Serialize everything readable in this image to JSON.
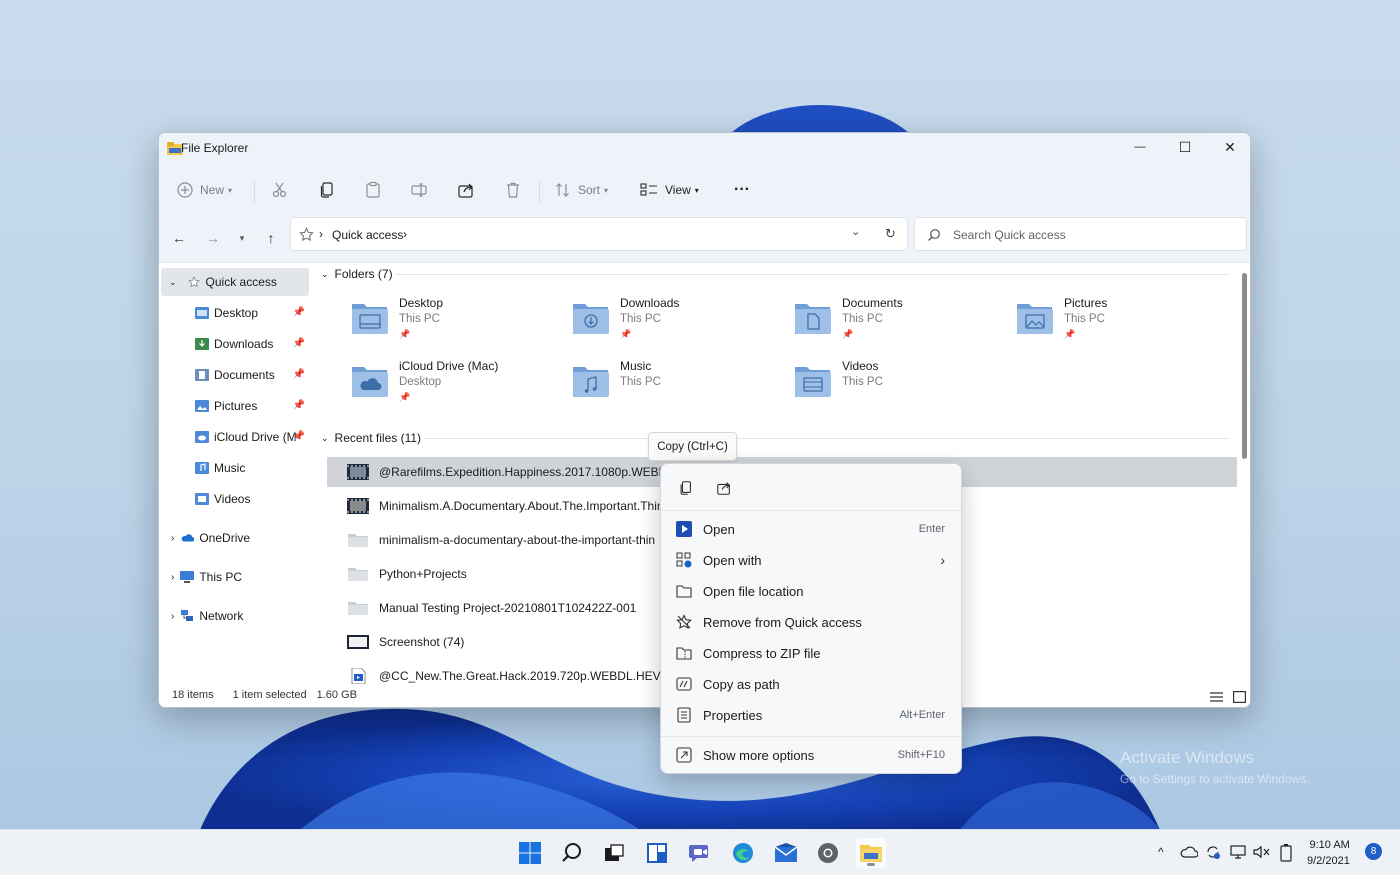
{
  "window": {
    "title": "File Explorer",
    "controls": {
      "minimize": "—",
      "maximize": "☐",
      "close": "✕"
    }
  },
  "toolbar": {
    "new_label": "New",
    "sort_label": "Sort",
    "view_label": "View",
    "more_label": "···"
  },
  "address": {
    "breadcrumb_root": "Quick access",
    "separator": "›",
    "search_placeholder": "Search Quick access"
  },
  "nav": {
    "quick_access": "Quick access",
    "pinned": [
      "Desktop",
      "Downloads",
      "Documents",
      "Pictures",
      "iCloud Drive (M",
      "Music",
      "Videos"
    ],
    "onedrive": "OneDrive",
    "this_pc": "This PC",
    "network": "Network"
  },
  "folders": {
    "header": "Folders (7)",
    "items": [
      {
        "name": "Desktop",
        "location": "This PC",
        "pinned": true
      },
      {
        "name": "Downloads",
        "location": "This PC",
        "pinned": true
      },
      {
        "name": "Documents",
        "location": "This PC",
        "pinned": true
      },
      {
        "name": "Pictures",
        "location": "This PC",
        "pinned": true
      },
      {
        "name": "iCloud Drive (Mac)",
        "location": "Desktop",
        "pinned": true
      },
      {
        "name": "Music",
        "location": "This PC",
        "pinned": false
      },
      {
        "name": "Videos",
        "location": "This PC",
        "pinned": false
      }
    ]
  },
  "recent": {
    "header": "Recent files (11)",
    "files": [
      "@Rarefilms.Expedition.Happiness.2017.1080p.WEBRip-",
      "Minimalism.A.Documentary.About.The.Important.Thing",
      "minimalism-a-documentary-about-the-important-thin",
      "Python+Projects",
      "Manual Testing Project-20210801T102422Z-001",
      "Screenshot (74)",
      "@CC_New.The.Great.Hack.2019.720p.WEBDL.HEVC"
    ]
  },
  "status": {
    "count": "18 items",
    "selection": "1 item selected",
    "size": "1.60 GB"
  },
  "tooltip": {
    "text": "Copy (Ctrl+C)"
  },
  "context_menu": {
    "items": [
      {
        "label": "Open",
        "shortcut": "Enter"
      },
      {
        "label": "Open with",
        "shortcut": "›"
      },
      {
        "label": "Open file location",
        "shortcut": ""
      },
      {
        "label": "Remove from Quick access",
        "shortcut": ""
      },
      {
        "label": "Compress to ZIP file",
        "shortcut": ""
      },
      {
        "label": "Copy as path",
        "shortcut": ""
      },
      {
        "label": "Properties",
        "shortcut": "Alt+Enter"
      },
      {
        "label": "Show more options",
        "shortcut": "Shift+F10"
      }
    ]
  },
  "watermark": {
    "line1": "Activate Windows",
    "line2": "Go to Settings to activate Windows."
  },
  "taskbar": {
    "time": "9:10 AM",
    "date": "9/2/2021",
    "notification_count": "8",
    "tray_chevron": "^"
  },
  "colors": {
    "accent": "#1f5dc9",
    "folder": "#8fb4df",
    "selection": "#d0d4d9"
  }
}
